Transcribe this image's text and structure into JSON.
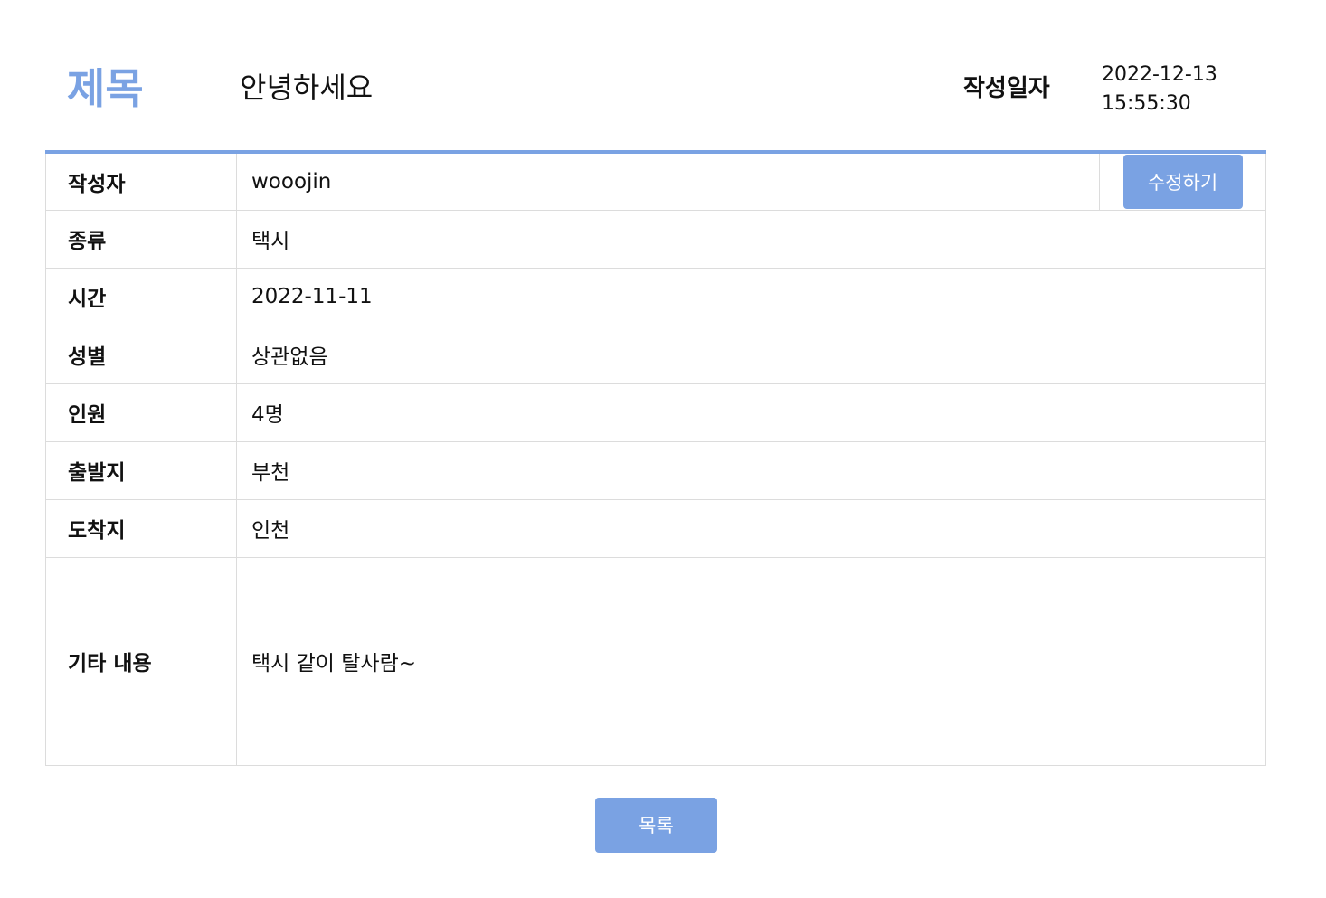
{
  "header": {
    "title_label": "제목",
    "title_value": "안녕하세요",
    "date_label": "작성일자",
    "date_value": "2022-12-13 15:55:30"
  },
  "details": {
    "writer_label": "작성자",
    "writer_value": "wooojin",
    "edit_button": "수정하기",
    "type_label": "종류",
    "type_value": "택시",
    "time_label": "시간",
    "time_value": "2022-11-11",
    "gender_label": "성별",
    "gender_value": "상관없음",
    "people_label": "인원",
    "people_value": "4명",
    "departure_label": "출발지",
    "departure_value": "부천",
    "arrival_label": "도착지",
    "arrival_value": "인천",
    "etc_label": "기타 내용",
    "etc_value": "택시 같이 탈사람~"
  },
  "footer": {
    "list_button": "목록"
  },
  "colors": {
    "accent": "#7aa2e3",
    "border": "#dcdcdc"
  }
}
